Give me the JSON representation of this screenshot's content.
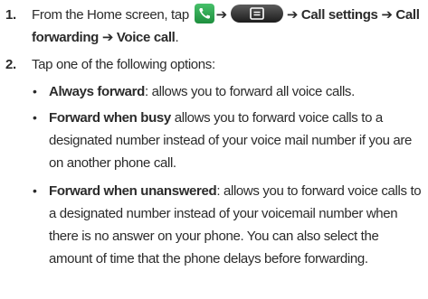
{
  "steps": [
    {
      "number": "1.",
      "parts": {
        "a": "From the Home screen, tap ",
        "arrow1": "➔",
        "arrow2": "➔",
        "b": "Call settings",
        "arrow3": "➔",
        "c": "Call forwarding",
        "arrow4": "➔",
        "d": "Voice call",
        "end": "."
      },
      "icons": [
        "phone-icon",
        "menu-key-icon"
      ]
    },
    {
      "number": "2.",
      "text": "Tap one of the following options:"
    }
  ],
  "options": [
    {
      "term": "Always forward",
      "desc": ": allows you to forward all voice calls."
    },
    {
      "term": "Forward when busy",
      "desc": " allows you to forward voice calls to a designated number instead of your voice mail number if you are on another phone call."
    },
    {
      "term": "Forward when unanswered",
      "desc": ": allows you to forward voice calls to a designated number instead of your voicemail number when there is no answer on your phone. You can also select the amount of time that the phone delays before forwarding."
    }
  ],
  "bullet_symbol": "•",
  "colors": {
    "text": "#2b2b2b",
    "phone_icon": "#2fa44f",
    "menu_key": "#2a2a2a"
  }
}
